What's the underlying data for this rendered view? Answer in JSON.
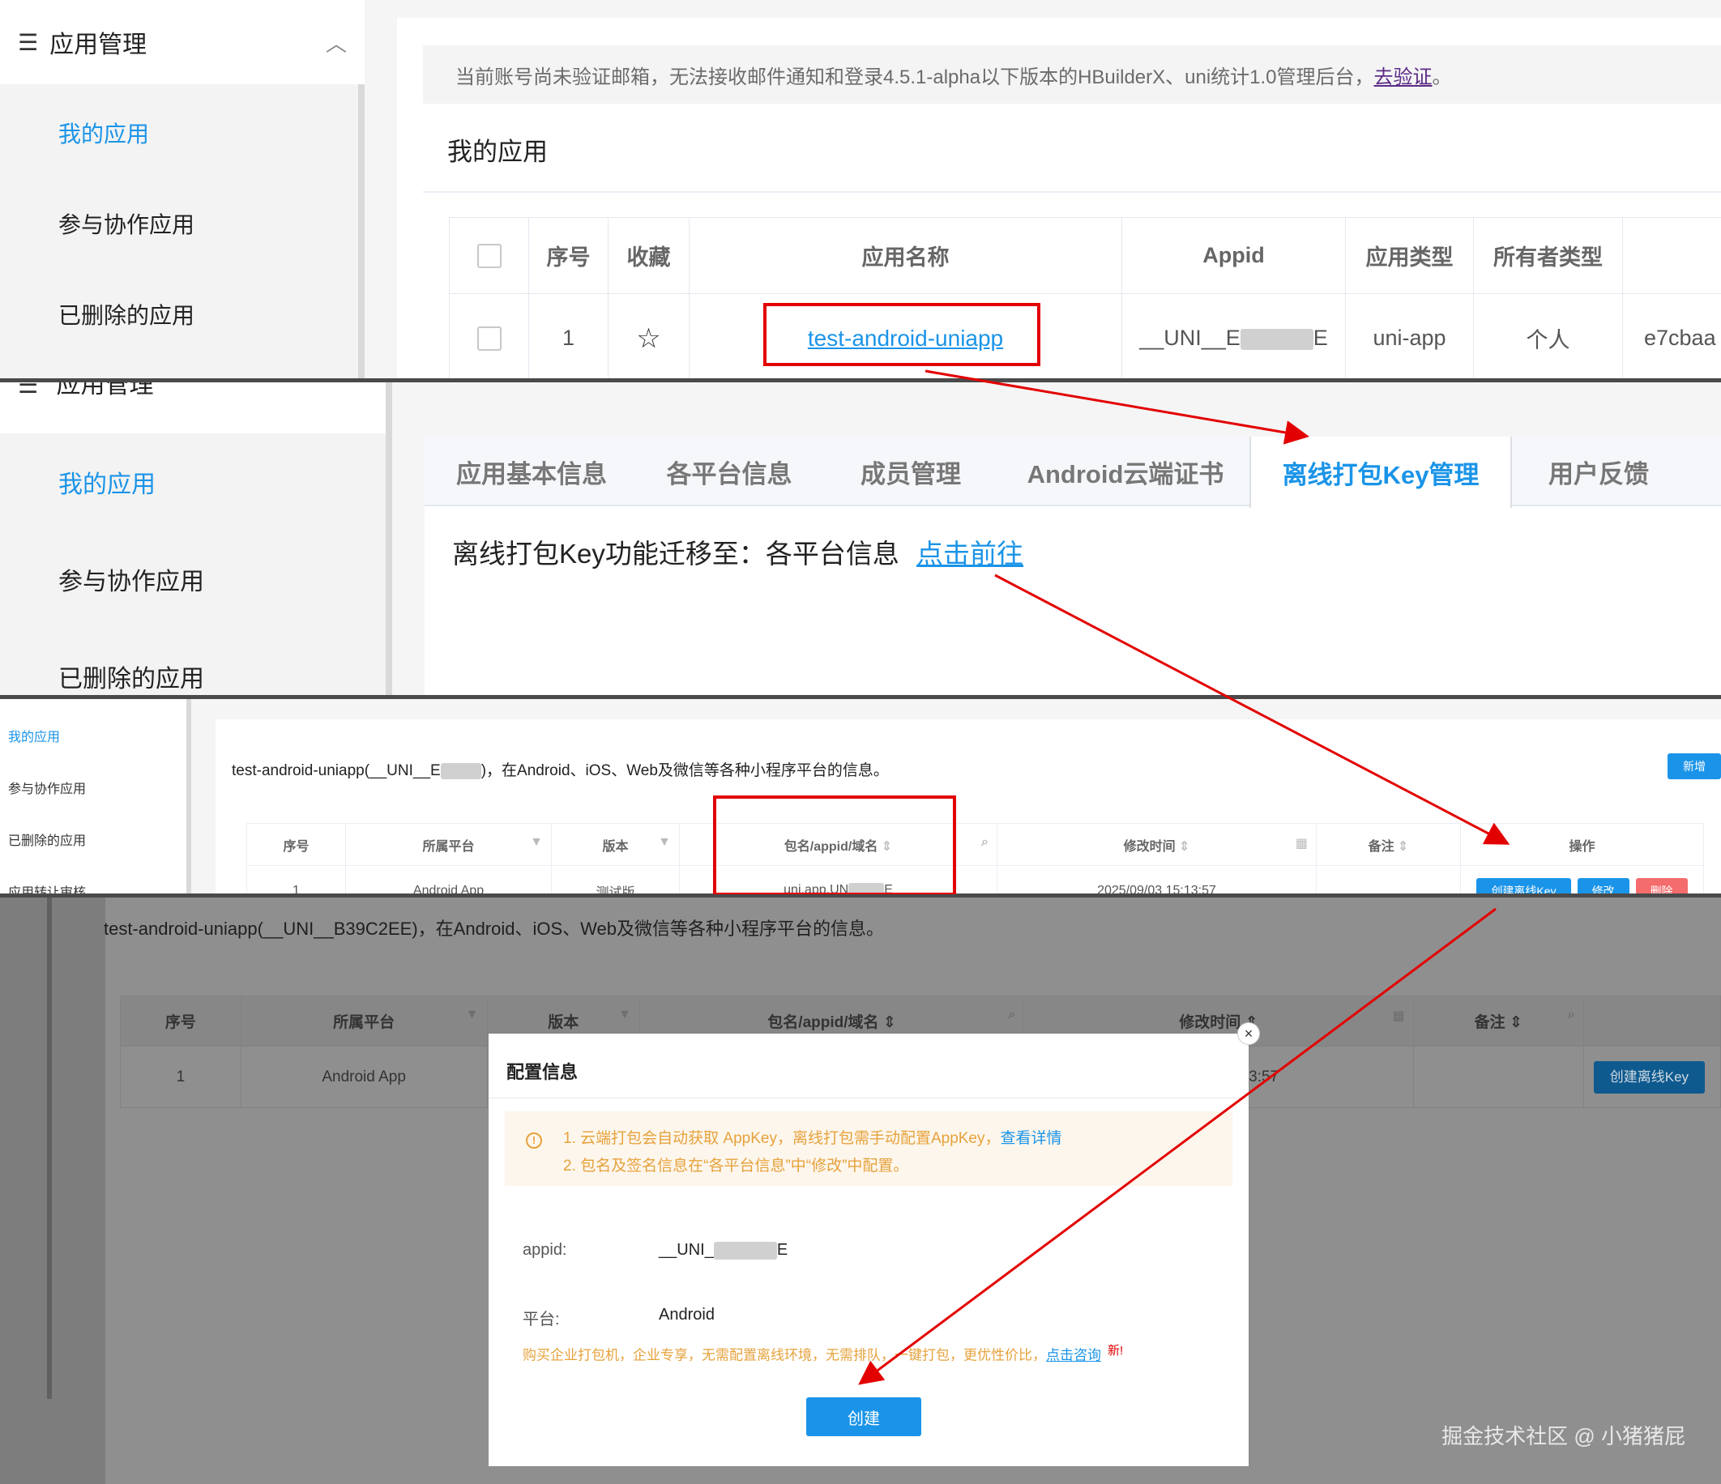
{
  "panel1": {
    "sidebar": {
      "header": "应用管理",
      "items": [
        {
          "label": "我的应用",
          "active": true
        },
        {
          "label": "参与协作应用",
          "active": false
        },
        {
          "label": "已删除的应用",
          "active": false
        }
      ]
    },
    "notice": {
      "text": "当前账号尚未验证邮箱，无法接收邮件通知和登录4.5.1-alpha以下版本的HBuilderX、uni统计1.0管理后台，",
      "link": "去验证",
      "suffix": "。"
    },
    "page_title": "我的应用",
    "table": {
      "headers": [
        "序号",
        "收藏",
        "应用名称",
        "Appid",
        "应用类型",
        "所有者类型"
      ],
      "row": {
        "index": "1",
        "name": "test-android-uniapp",
        "appid": "__UNI__E",
        "appid_tail": "E",
        "type": "uni-app",
        "owner": "个人",
        "extra": "e7cbaa"
      }
    }
  },
  "panel2": {
    "sidebar": {
      "header": "应用管理",
      "items": [
        {
          "label": "我的应用",
          "active": true
        },
        {
          "label": "参与协作应用",
          "active": false
        },
        {
          "label": "已删除的应用",
          "active": false
        }
      ]
    },
    "tabs": [
      "应用基本信息",
      "各平台信息",
      "成员管理",
      "Android云端证书",
      "离线打包Key管理",
      "用户反馈"
    ],
    "active_tab": "离线打包Key管理",
    "migrate_text": "离线打包Key功能迁移至：各平台信息",
    "migrate_link": "点击前往"
  },
  "panel3": {
    "sidebar": {
      "items": [
        {
          "label": "我的应用",
          "active": true
        },
        {
          "label": "参与协作应用",
          "active": false
        },
        {
          "label": "已删除的应用",
          "active": false
        },
        {
          "label": "应用转让审核",
          "active": false
        }
      ]
    },
    "desc_prefix": "test-android-uniapp(__UNI__E",
    "desc_suffix": ")，在Android、iOS、Web及微信等各种小程序平台的信息。",
    "add_button": "新增",
    "table": {
      "headers": [
        "序号",
        "所属平台",
        "版本",
        "包名/appid/域名",
        "修改时间",
        "备注",
        "操作"
      ],
      "row": {
        "index": "1",
        "platform": "Android App",
        "version": "测试版",
        "package": "uni.app.UN",
        "package_tail": "E",
        "modified": "2025/09/03 15:13:57",
        "note": ""
      },
      "actions": [
        "创建离线Key",
        "修改",
        "删除"
      ]
    }
  },
  "panel4": {
    "desc": "test-android-uniapp(__UNI__B39C2EE)，在Android、iOS、Web及微信等各种小程序平台的信息。",
    "table": {
      "headers": [
        "序号",
        "所属平台",
        "版本",
        "包名/appid/域名",
        "修改时间",
        "备注"
      ],
      "row": {
        "index": "1",
        "platform": "Android App",
        "modified_tail": "15:13:57",
        "action": "创建离线Key"
      }
    },
    "modal": {
      "title": "配置信息",
      "close": "×",
      "alert_line1": "1. 云端打包会自动获取 AppKey，离线打包需手动配置AppKey，",
      "alert_link": "查看详情",
      "alert_line2": "2. 包名及签名信息在“各平台信息”中“修改”中配置。",
      "appid_label": "appid:",
      "appid_value": "__UNI_",
      "appid_tail": "E",
      "platform_label": "平台:",
      "platform_value": "Android",
      "promo_text": "购买企业打包机，企业专享，无需配置离线环境，无需排队，一键打包，更优性价比，",
      "promo_link": "点击咨询",
      "promo_new": "新!",
      "create_button": "创建"
    },
    "watermark": "掘金技术社区 @ 小猪猪屁"
  },
  "colors": {
    "accent": "#1a94e8",
    "highlight": "#e30000",
    "warning": "#e6a23c",
    "danger": "#f56c6c"
  },
  "icons": [
    "list-icon",
    "chevron-up-icon",
    "star-icon",
    "filter-icon",
    "search-icon",
    "sort-icon",
    "calendar-icon",
    "info-icon",
    "close-icon"
  ]
}
